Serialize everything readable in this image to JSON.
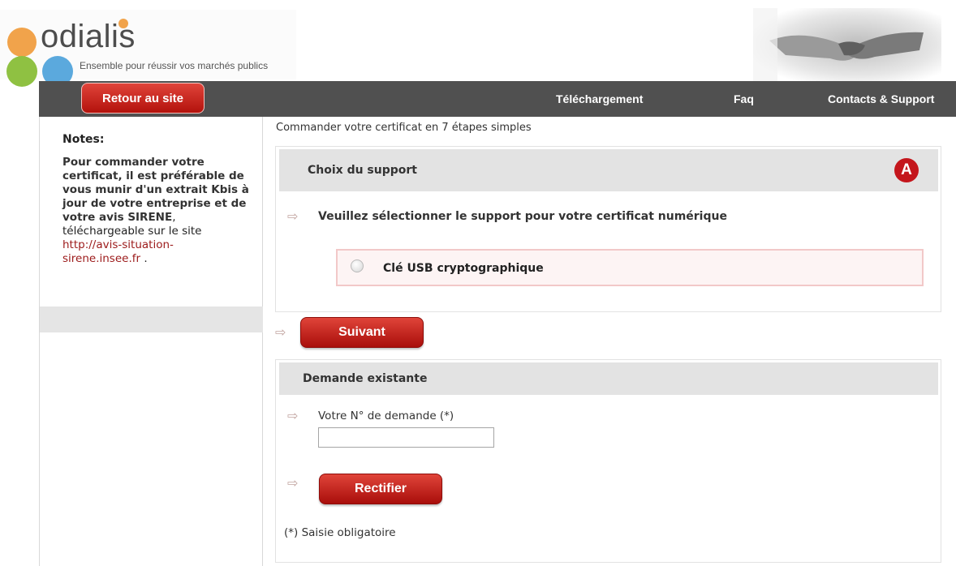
{
  "header": {
    "logo_text": "odialis",
    "tagline": "Ensemble pour réussir vos marchés publics"
  },
  "nav": {
    "back_button": "Retour au site",
    "links": [
      "Téléchargement",
      "Faq",
      "Contacts & Support"
    ]
  },
  "sidebar": {
    "notes_title": "Notes:",
    "notes_bold": "Pour commander votre certificat, il est préférable de vous munir d'un extrait Kbis à jour de votre entreprise et de votre avis SIRENE",
    "notes_normal": ", téléchargeable sur le site ",
    "notes_link": "http://avis-situation-sirene.insee.fr",
    "notes_end": " ."
  },
  "main": {
    "intro": "Commander votre certificat en 7 étapes simples",
    "support_panel": {
      "title": "Choix du support",
      "step_letter": "A",
      "question": "Veuillez sélectionner le support pour votre certificat numérique",
      "option_label": "Clé USB cryptographique"
    },
    "next_button": "Suivant",
    "existing_panel": {
      "title": "Demande existante",
      "request_label": "Votre N° de demande (*)",
      "request_value": "",
      "rectify_button": "Rectifier",
      "mandatory_note": "(*) Saisie obligatoire"
    }
  },
  "colors": {
    "nav_bg": "#505050",
    "button_red": "#c4161c",
    "panel_header": "#e3e3e3"
  }
}
